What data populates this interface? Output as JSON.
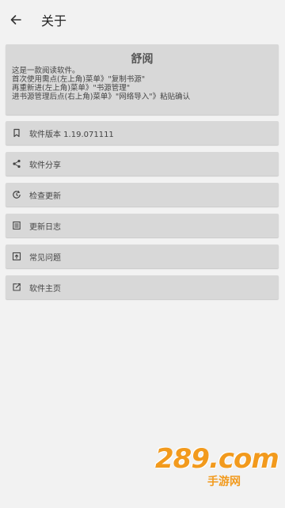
{
  "header": {
    "back_icon": "arrow-left-icon",
    "title": "关于"
  },
  "about": {
    "app_name": "舒阅",
    "lines": [
      "这是一款阅读软件。",
      "首次使用需点(左上角)菜单》\"复制书源\"",
      "再重新进(左上角)菜单》\"书源管理\"",
      "进书源管理后点(右上角)菜单》\"网络导入\"》粘贴确认"
    ]
  },
  "menu": [
    {
      "icon": "bookmark-icon",
      "label": "软件版本 1.19.071111"
    },
    {
      "icon": "share-icon",
      "label": "软件分享"
    },
    {
      "icon": "update-check-icon",
      "label": "检查更新"
    },
    {
      "icon": "log-icon",
      "label": "更新日志"
    },
    {
      "icon": "faq-icon",
      "label": "常见问题"
    },
    {
      "icon": "external-link-icon",
      "label": "软件主页"
    }
  ],
  "watermark": {
    "main": "289.com",
    "sub": "手游网"
  },
  "colors": {
    "background": "#f2f2f2",
    "card": "#d8d8d8",
    "watermark": "#f29a1d"
  }
}
